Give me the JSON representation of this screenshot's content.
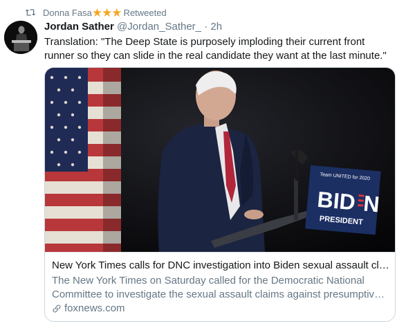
{
  "retweet": {
    "icon": "retweet-icon",
    "name": "Donna Fasa",
    "stars": "★★★",
    "label": "Retweeted"
  },
  "tweet": {
    "display_name": "Jordan Sather",
    "handle": "@Jordan_Sather_",
    "separator": "·",
    "time": "2h",
    "text": "Translation: \"The Deep State is purposely imploding their current front runner so they can slide in the real candidate they want at the last minute.\""
  },
  "card": {
    "image_sign": {
      "small": "Team UNITED for 2020",
      "name_part1": "BID",
      "name_part2": "N",
      "subtitle": "PRESIDENT"
    },
    "title": "New York Times calls for DNC investigation into Biden sexual assault claims",
    "desc_line1": "The New York Times on Saturday called for the Democratic National",
    "desc_line2": "Committee to investigate the sexual assault claims against presumptive nominee",
    "domain": "foxnews.com"
  },
  "colors": {
    "text": "#14171a",
    "secondary": "#657786",
    "border": "#ccd6dd",
    "star": "#f5a623",
    "sign_bg": "#1c2f63"
  }
}
